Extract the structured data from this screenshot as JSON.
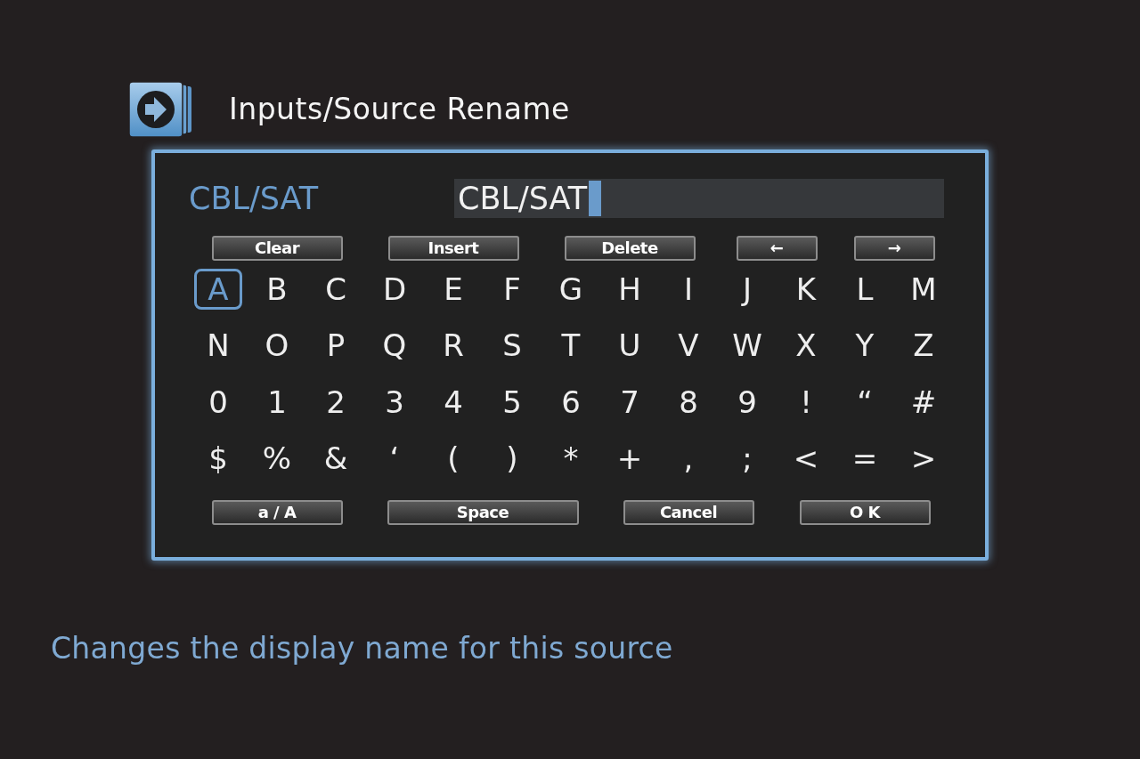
{
  "header": {
    "title": "Inputs/Source Rename"
  },
  "editor": {
    "source_label": "CBL/SAT",
    "name_field": {
      "value": "CBL/SAT"
    },
    "edit_buttons": [
      "Clear",
      "Insert",
      "Delete",
      "←",
      "→"
    ],
    "keys": [
      {
        "label": "A",
        "selected": true
      },
      {
        "label": "B",
        "selected": false
      },
      {
        "label": "C",
        "selected": false
      },
      {
        "label": "D",
        "selected": false
      },
      {
        "label": "E",
        "selected": false
      },
      {
        "label": "F",
        "selected": false
      },
      {
        "label": "G",
        "selected": false
      },
      {
        "label": "H",
        "selected": false
      },
      {
        "label": "I",
        "selected": false
      },
      {
        "label": "J",
        "selected": false
      },
      {
        "label": "K",
        "selected": false
      },
      {
        "label": "L",
        "selected": false
      },
      {
        "label": "M",
        "selected": false
      },
      {
        "label": "N",
        "selected": false
      },
      {
        "label": "O",
        "selected": false
      },
      {
        "label": "P",
        "selected": false
      },
      {
        "label": "Q",
        "selected": false
      },
      {
        "label": "R",
        "selected": false
      },
      {
        "label": "S",
        "selected": false
      },
      {
        "label": "T",
        "selected": false
      },
      {
        "label": "U",
        "selected": false
      },
      {
        "label": "V",
        "selected": false
      },
      {
        "label": "W",
        "selected": false
      },
      {
        "label": "X",
        "selected": false
      },
      {
        "label": "Y",
        "selected": false
      },
      {
        "label": "Z",
        "selected": false
      },
      {
        "label": "0",
        "selected": false
      },
      {
        "label": "1",
        "selected": false
      },
      {
        "label": "2",
        "selected": false
      },
      {
        "label": "3",
        "selected": false
      },
      {
        "label": "4",
        "selected": false
      },
      {
        "label": "5",
        "selected": false
      },
      {
        "label": "6",
        "selected": false
      },
      {
        "label": "7",
        "selected": false
      },
      {
        "label": "8",
        "selected": false
      },
      {
        "label": "9",
        "selected": false
      },
      {
        "label": "!",
        "selected": false
      },
      {
        "label": "“",
        "selected": false
      },
      {
        "label": "#",
        "selected": false
      },
      {
        "label": "$",
        "selected": false
      },
      {
        "label": "%",
        "selected": false
      },
      {
        "label": "&",
        "selected": false
      },
      {
        "label": "‘",
        "selected": false
      },
      {
        "label": "(",
        "selected": false
      },
      {
        "label": ")",
        "selected": false
      },
      {
        "label": "*",
        "selected": false
      },
      {
        "label": "+",
        "selected": false
      },
      {
        "label": ",",
        "selected": false
      },
      {
        "label": ";",
        "selected": false
      },
      {
        "label": "<",
        "selected": false
      },
      {
        "label": "=",
        "selected": false
      },
      {
        "label": ">",
        "selected": false
      }
    ],
    "action_buttons": [
      "a / A",
      "Space",
      "Cancel",
      "O K"
    ]
  },
  "help_text": "Changes the display name for this source"
}
